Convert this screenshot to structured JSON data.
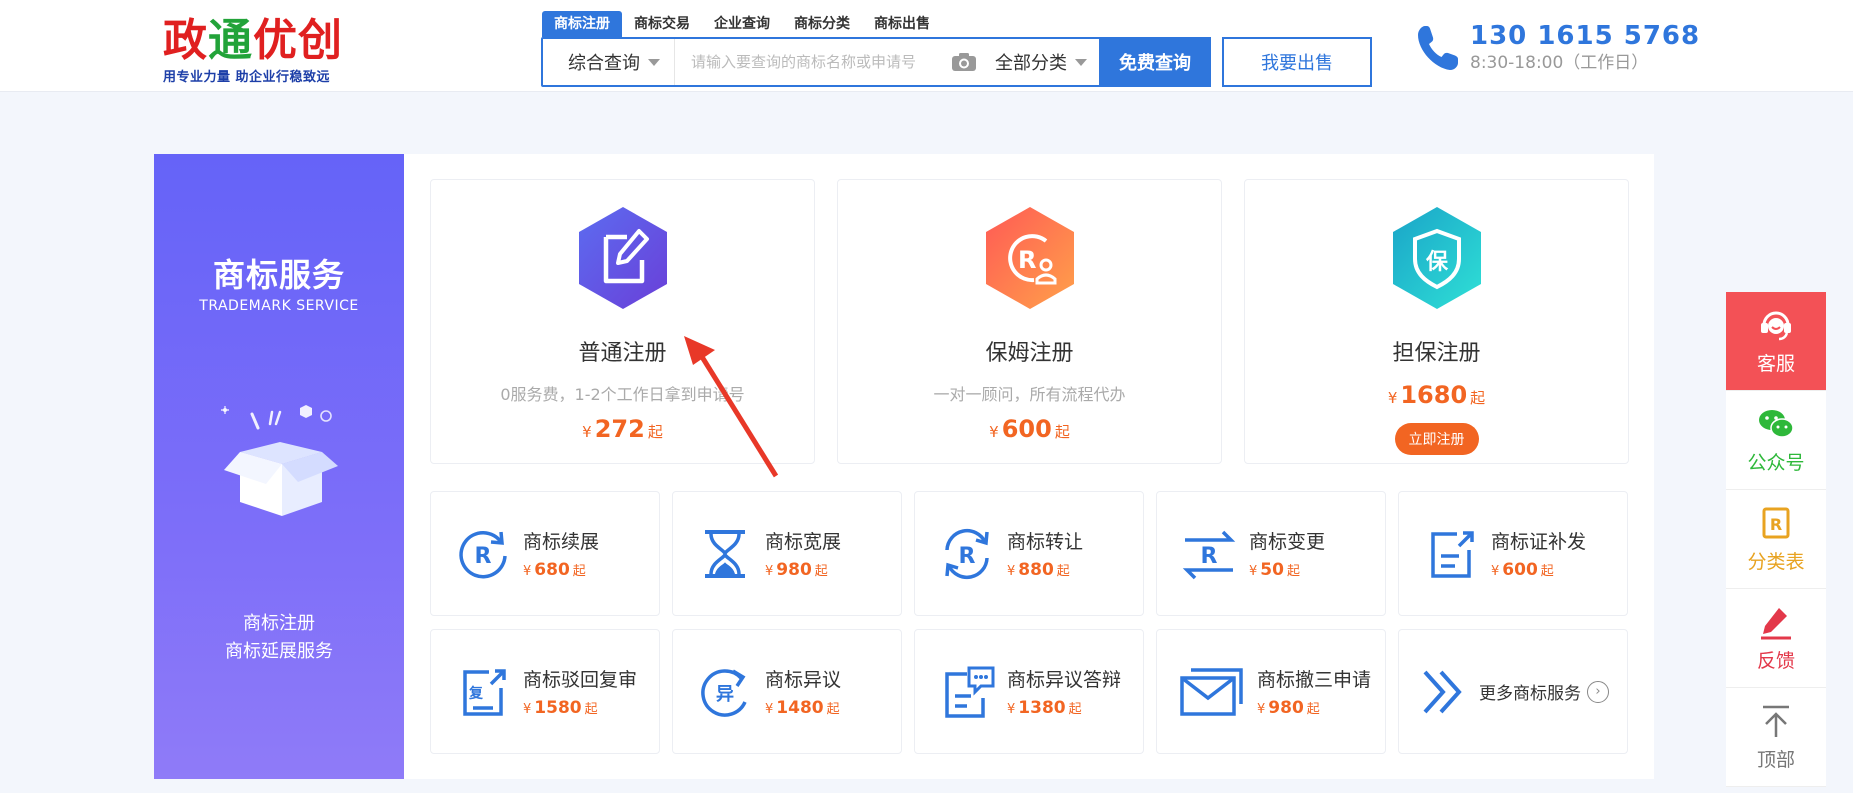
{
  "logo": {
    "title_1": "政",
    "title_2": "通",
    "title_3": "优创",
    "slogan": "用专业力量  助企业行稳致远"
  },
  "search": {
    "tabs": [
      "商标注册",
      "商标交易",
      "企业查询",
      "商标分类",
      "商标出售"
    ],
    "scope": "综合查询",
    "placeholder": "请输入要查询的商标名称或申请号",
    "category": "全部分类",
    "submit": "免费查询"
  },
  "sell_button": "我要出售",
  "contact": {
    "phone": "130 1615 5768",
    "hours": "8:30-18:00（工作日）"
  },
  "panel": {
    "title": "商标服务",
    "subtitle": "TRADEMARK SERVICE",
    "desc_1": "商标注册",
    "desc_2": "商标延展服务"
  },
  "cards": [
    {
      "title": "普通注册",
      "desc": "0服务费，1-2个工作日拿到申请号",
      "yen": "¥",
      "price": "272",
      "suffix": "起"
    },
    {
      "title": "保姆注册",
      "desc": "一对一顾问，所有流程代办",
      "yen": "¥",
      "price": "600",
      "suffix": "起"
    },
    {
      "title": "担保注册",
      "yen": "¥",
      "price": "1680",
      "suffix": "起",
      "button": "立即注册"
    }
  ],
  "services": [
    {
      "name": "商标续展",
      "yen": "¥",
      "price": "680",
      "suffix": "起",
      "icon": "renew-r-icon"
    },
    {
      "name": "商标宽展",
      "yen": "¥",
      "price": "980",
      "suffix": "起",
      "icon": "hourglass-icon"
    },
    {
      "name": "商标转让",
      "yen": "¥",
      "price": "880",
      "suffix": "起",
      "icon": "transfer-r-icon"
    },
    {
      "name": "商标变更",
      "yen": "¥",
      "price": "50",
      "suffix": "起",
      "icon": "change-r-icon"
    },
    {
      "name": "商标证补发",
      "yen": "¥",
      "price": "600",
      "suffix": "起",
      "icon": "certificate-icon"
    },
    {
      "name": "商标驳回复审",
      "yen": "¥",
      "price": "1580",
      "suffix": "起",
      "icon": "review-icon",
      "icon_text": "复"
    },
    {
      "name": "商标异议",
      "yen": "¥",
      "price": "1480",
      "suffix": "起",
      "icon": "objection-icon",
      "icon_text": "异"
    },
    {
      "name": "商标异议答辩",
      "yen": "¥",
      "price": "1380",
      "suffix": "起",
      "icon": "defense-icon"
    },
    {
      "name": "商标撤三申请",
      "yen": "¥",
      "price": "980",
      "suffix": "起",
      "icon": "envelope-icon"
    }
  ],
  "more": {
    "label": "更多商标服务",
    "arrow": "›"
  },
  "sidebar": {
    "service": "客服",
    "wechat": "公众号",
    "catalog": "分类表",
    "feedback": "反馈",
    "top": "顶部"
  },
  "colors": {
    "primary": "#2f76dc",
    "price": "#f26522",
    "panel_from": "#6563f8",
    "panel_to": "#8f7bf8",
    "service_red": "#f35156"
  }
}
